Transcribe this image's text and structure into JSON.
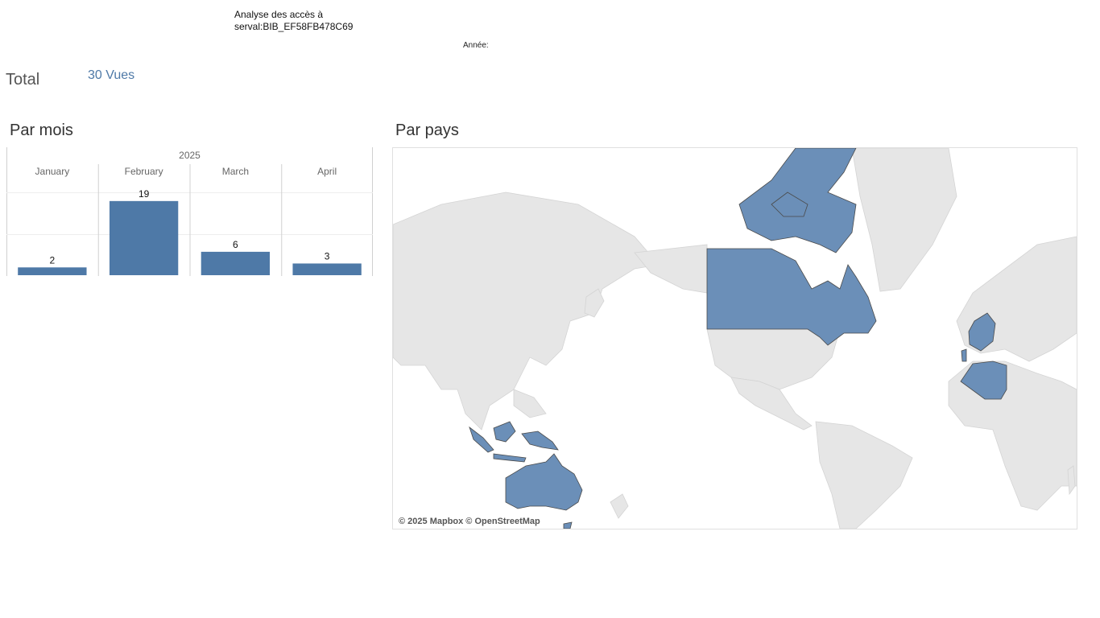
{
  "header": {
    "title": "Analyse des accès à\n serval:BIB_EF58FB478C69",
    "year_filter_label": "Année:"
  },
  "total": {
    "label": "Total",
    "value": "30 Vues"
  },
  "sections": {
    "by_month": "Par mois",
    "by_country": "Par pays"
  },
  "chart_data": {
    "type": "bar",
    "title": "",
    "group_label": "2025",
    "categories": [
      "January",
      "February",
      "March",
      "April"
    ],
    "values": [
      2,
      19,
      6,
      3
    ],
    "data_labels": [
      "2",
      "19",
      "6",
      "3"
    ],
    "ylim": [
      0,
      20
    ],
    "grid": true,
    "bar_color": "#4e79a7",
    "xlabel": "",
    "ylabel": ""
  },
  "map": {
    "highlighted_countries": [
      "Canada",
      "France",
      "Portugal",
      "Algeria",
      "Indonesia",
      "Australia"
    ],
    "highlight_color": "#6b8fb8",
    "land_color": "#e6e6e6",
    "attribution": "© 2025 Mapbox © OpenStreetMap"
  }
}
